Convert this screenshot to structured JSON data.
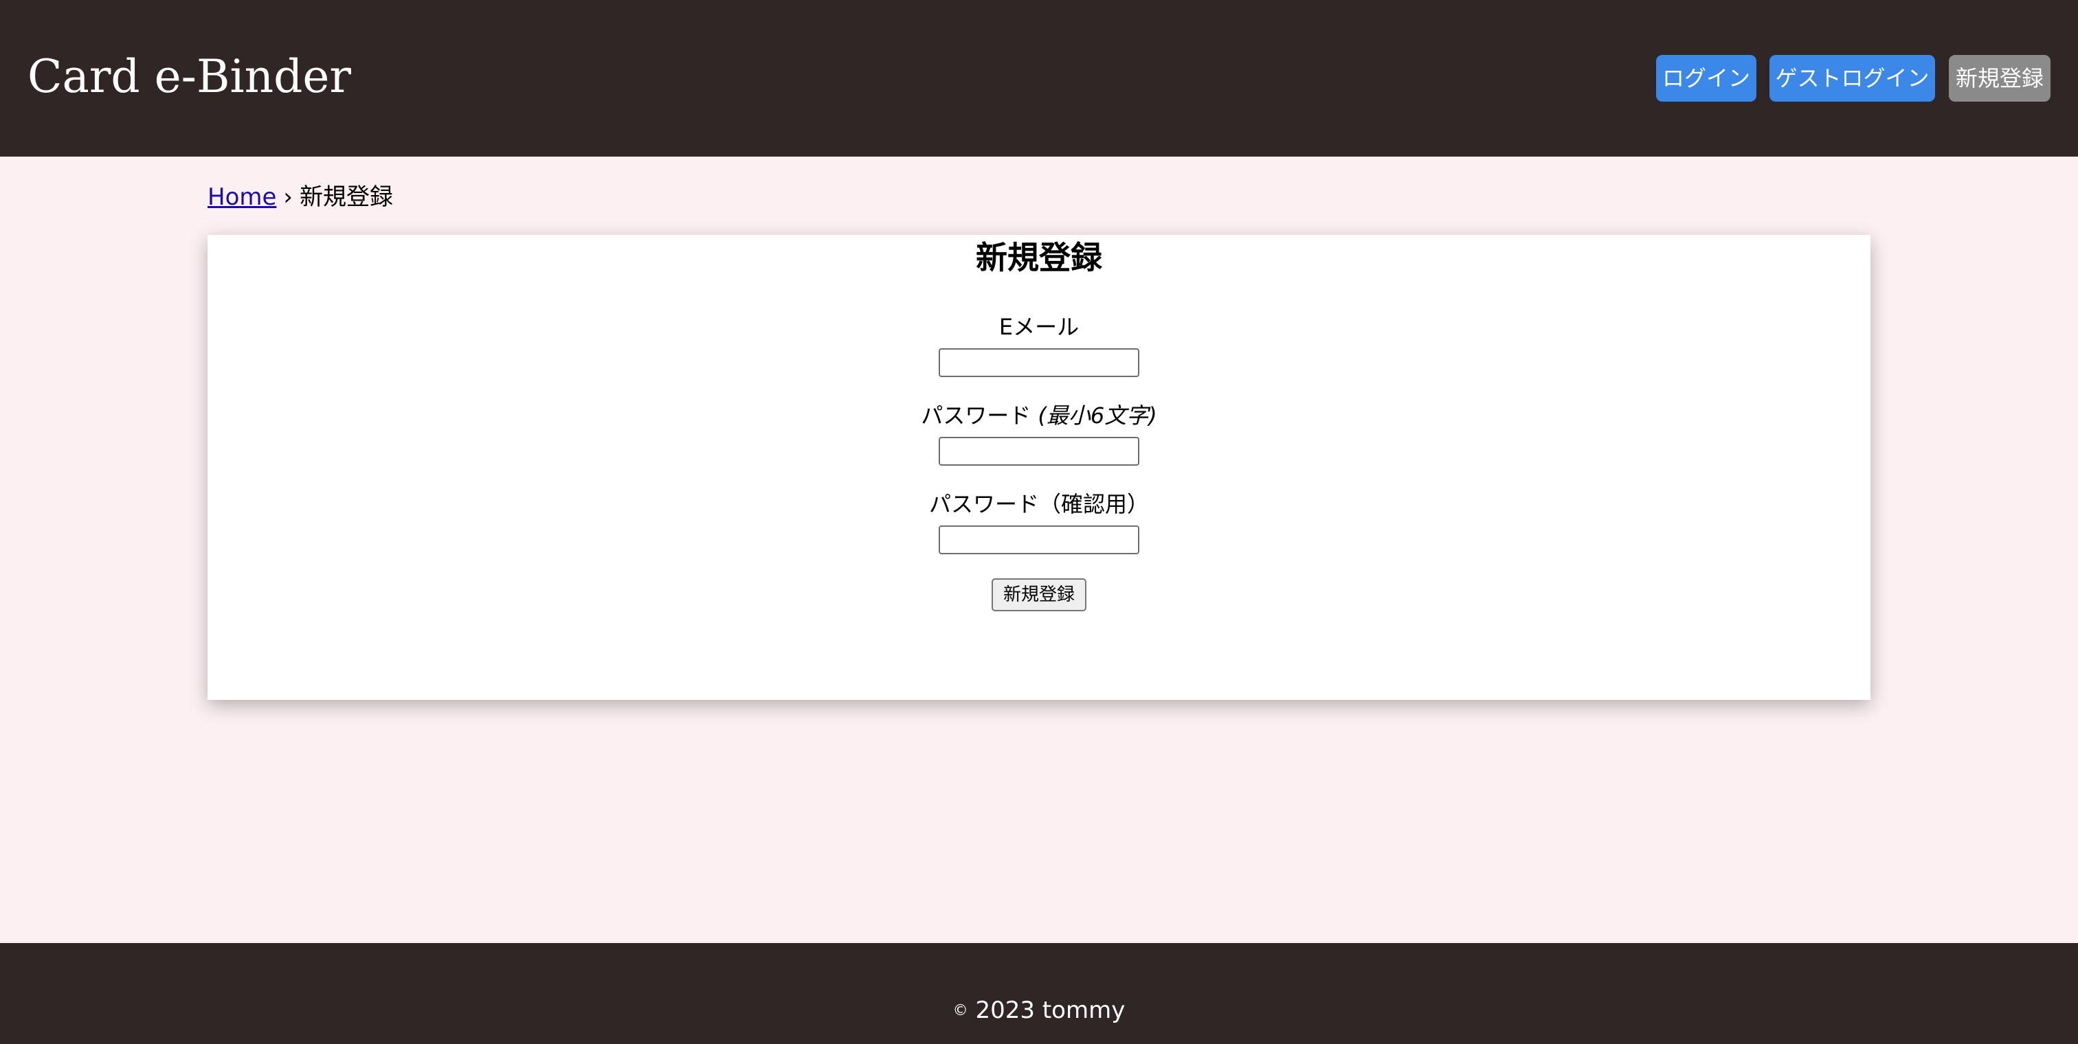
{
  "header": {
    "brand": "Card e-Binder",
    "nav": {
      "login": "ログイン",
      "guest_login": "ゲストログイン",
      "register": "新規登録"
    }
  },
  "breadcrumb": {
    "home": "Home",
    "separator": "›",
    "current": "新規登録"
  },
  "form": {
    "title": "新規登録",
    "email_label": "Eメール",
    "email_value": "",
    "password_label": "パスワード",
    "password_hint": "(最小6文字)",
    "password_value": "",
    "confirm_label": "パスワード（確認用）",
    "confirm_value": "",
    "submit_label": "新規登録"
  },
  "footer": {
    "copyright_symbol": "©",
    "copyright_text": "2023 tommy"
  },
  "colors": {
    "header_bg": "#302626",
    "page_bg": "#fcf0f3",
    "primary_button": "#3b88e8",
    "secondary_button": "#8a8a8a"
  }
}
